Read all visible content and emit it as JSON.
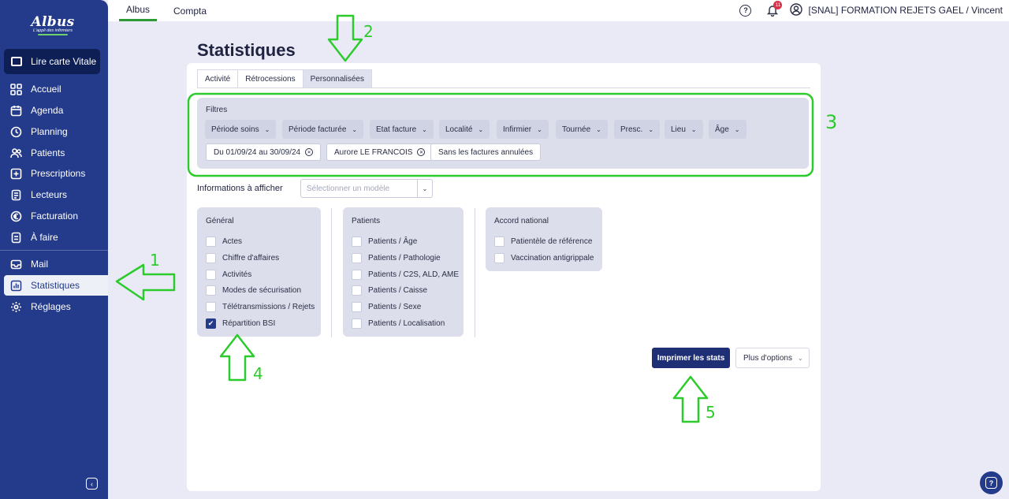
{
  "sidebar": {
    "logo_brand": "Albus",
    "logo_tag": "L'appli des infirmiers",
    "vitale_label": "Lire carte Vitale",
    "items": [
      {
        "label": "Accueil",
        "icon": "grid-icon"
      },
      {
        "label": "Agenda",
        "icon": "calendar-icon"
      },
      {
        "label": "Planning",
        "icon": "clock-icon"
      },
      {
        "label": "Patients",
        "icon": "users-icon"
      },
      {
        "label": "Prescriptions",
        "icon": "prescription-icon"
      },
      {
        "label": "Lecteurs",
        "icon": "reader-icon"
      },
      {
        "label": "Facturation",
        "icon": "euro-icon"
      },
      {
        "label": "À faire",
        "icon": "todo-icon"
      }
    ],
    "items2": [
      {
        "label": "Mail",
        "icon": "mail-icon"
      },
      {
        "label": "Statistiques",
        "icon": "stats-icon",
        "active": true
      },
      {
        "label": "Réglages",
        "icon": "gear-icon"
      }
    ]
  },
  "topbar": {
    "tabs": [
      "Albus",
      "Compta"
    ],
    "notification_count": "11",
    "user": "[SNAL] FORMATION REJETS GAEL / Vincent"
  },
  "page": {
    "title": "Statistiques",
    "tabs": [
      "Activité",
      "Rétrocessions",
      "Personnalisées"
    ],
    "filters": {
      "title": "Filtres",
      "dropdowns": [
        "Période soins",
        "Période facturée",
        "Etat facture",
        "Localité",
        "Infirmier",
        "Tournée",
        "Presc.",
        "Lieu",
        "Âge"
      ],
      "chips": [
        "Du 01/09/24 au 30/09/24",
        "Aurore LE FRANCOIS",
        "Sans les factures annulées"
      ]
    },
    "info_label": "Informations à afficher",
    "model_placeholder": "Sélectionner un modèle",
    "groups": {
      "general": {
        "title": "Général",
        "options": [
          "Actes",
          "Chiffre d'affaires",
          "Activités",
          "Modes de sécurisation",
          "Télétransmissions / Rejets",
          "Répartition BSI"
        ],
        "checked_index": 5
      },
      "patients": {
        "title": "Patients",
        "options": [
          "Patients / Âge",
          "Patients / Pathologie",
          "Patients / C2S, ALD, AME",
          "Patients / Caisse",
          "Patients / Sexe",
          "Patients / Localisation"
        ]
      },
      "accord": {
        "title": "Accord national",
        "options": [
          "Patientèle de référence",
          "Vaccination antigrippale"
        ]
      }
    },
    "print_label": "Imprimer les stats",
    "more_label": "Plus d'options"
  },
  "annotations": {
    "numbers": [
      "1",
      "2",
      "3",
      "4",
      "5"
    ],
    "color": "#2ccb2c"
  }
}
